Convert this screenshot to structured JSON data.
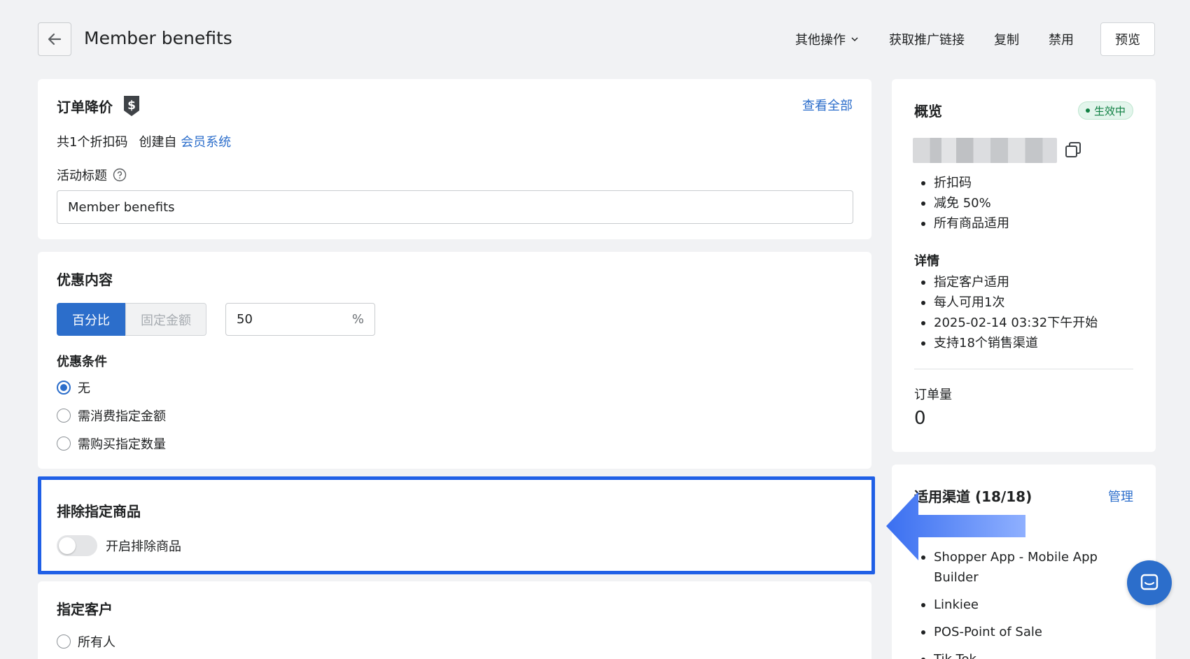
{
  "header": {
    "title": "Member benefits",
    "more_actions": "其他操作",
    "get_link": "获取推广链接",
    "copy": "复制",
    "disable": "禁用",
    "preview": "预览"
  },
  "discount_card": {
    "title": "订单降价",
    "view_all": "查看全部",
    "code_count": "共1个折扣码",
    "created_from_label": "创建自",
    "created_from_link": "会员系统",
    "activity_title_label": "活动标题",
    "activity_title_value": "Member benefits"
  },
  "offer_card": {
    "title": "优惠内容",
    "seg_percent": "百分比",
    "seg_fixed": "固定金额",
    "value": "50",
    "unit": "%",
    "condition_title": "优惠条件",
    "conditions": [
      "无",
      "需消费指定金额",
      "需购买指定数量"
    ],
    "selected_condition": 0
  },
  "exclude_card": {
    "title": "排除指定商品",
    "toggle_label": "开启排除商品",
    "toggle_on": false
  },
  "customer_card": {
    "title": "指定客户",
    "option_all": "所有人"
  },
  "overview": {
    "title": "概览",
    "status": "生效中",
    "summary": [
      "折扣码",
      "减免 50%",
      "所有商品适用"
    ],
    "details_title": "详情",
    "details": [
      "指定客户适用",
      "每人可用1次",
      "2025-02-14 03:32下午开始",
      "支持18个销售渠道"
    ],
    "orders_label": "订单量",
    "orders_value": "0"
  },
  "channels": {
    "title": "适用渠道 (18/18)",
    "manage": "管理",
    "items": [
      "Shopper App - Mobile App Builder",
      "Linkiee",
      "POS-Point of Sale",
      "Tik Tok"
    ]
  },
  "colors": {
    "accent": "#2c6ecb",
    "highlight": "#1f5fe6",
    "status_green": "#108043",
    "background": "#f1f2f4"
  },
  "icons": {
    "back": "arrow-left-icon",
    "discount": "price-tag-dollar-icon",
    "help": "question-circle-icon",
    "copy": "copy-icon",
    "chat": "chat-bubble-icon",
    "dropdown": "chevron-down-icon"
  }
}
